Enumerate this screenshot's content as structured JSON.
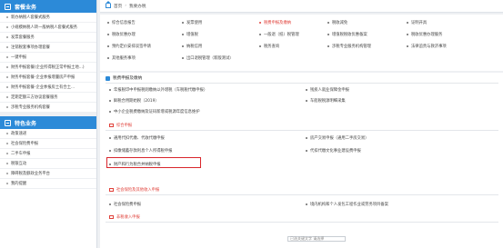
{
  "sidebar": {
    "section1_title": "套餐业务",
    "section1_items": [
      "新办纳税人套餐式服务",
      "小规模纳税人转一般纳税人套餐式服务",
      "发票套餐服务",
      "注销税套事项办理套餐",
      "一键申报",
      "财务申报套餐(企业所得税正常申报土地...)",
      "财务申报套餐-企业季报增量房产申报",
      "财务申报套餐-企业季报房土有合土...",
      "定期定额三方协议套餐服务",
      "涉税专业服务机构套餐"
    ],
    "section2_title": "特色业务",
    "section2_items": [
      "政策速递",
      "社会保险费申报",
      "二手车申报",
      "税银互动",
      "障碍税及额政业务平台",
      "我的提醒"
    ]
  },
  "breadcrumb": {
    "home": "首页",
    "current": "我要办税"
  },
  "menu": {
    "col1": [
      "综合信息报告",
      "税收优惠办理",
      "预约定价安排谈签申请",
      "其他服务事项"
    ],
    "col2": [
      "发票使用",
      "增值税",
      "纳税信用",
      "出口退税管理（新版测试）"
    ],
    "col3": [
      "税费申报及缴纳",
      "一般退（抵）税管理",
      "税务查询"
    ],
    "col4": [
      "税收减免",
      "增值税税收优惠备案",
      "涉税专业服务机构管理"
    ],
    "col5": [
      "证明开具",
      "税收优惠办理服务",
      "法律追责与救济事项"
    ]
  },
  "content": {
    "section_title": "税费申报及缴纳",
    "general_rows": [
      "年报税印中申报税则缴纳以外增税（车税税代缴申报）",
      "残疾人就业保障金申报",
      "鲜税合用期始税（2019）",
      "车船税税源明细采集",
      "中小企业税费缴纳及证码新增或税源年度信息维护"
    ],
    "sub1_title": "综合申报",
    "sub1_rows_left": [
      "通用代扣代缴、代收代缴申报",
      "扣缴储蓄存款利息个人所得税申报",
      "财产和行为税合并纳税申报"
    ],
    "sub1_rows_right": [
      "房产交易申报（通用二手房交易）",
      "代扣代缴文化事业建设费申报"
    ],
    "sub2_title": "社会保险及其他收入申报",
    "sub2_rows_left": [
      "社会保险费申报"
    ],
    "sub2_rows_right": [
      "境内机构和个人发包工程作业或劳务项目备案"
    ],
    "sub3_title": "非税收入申报",
    "input_placeholder": "已选关键文字  请选择"
  }
}
